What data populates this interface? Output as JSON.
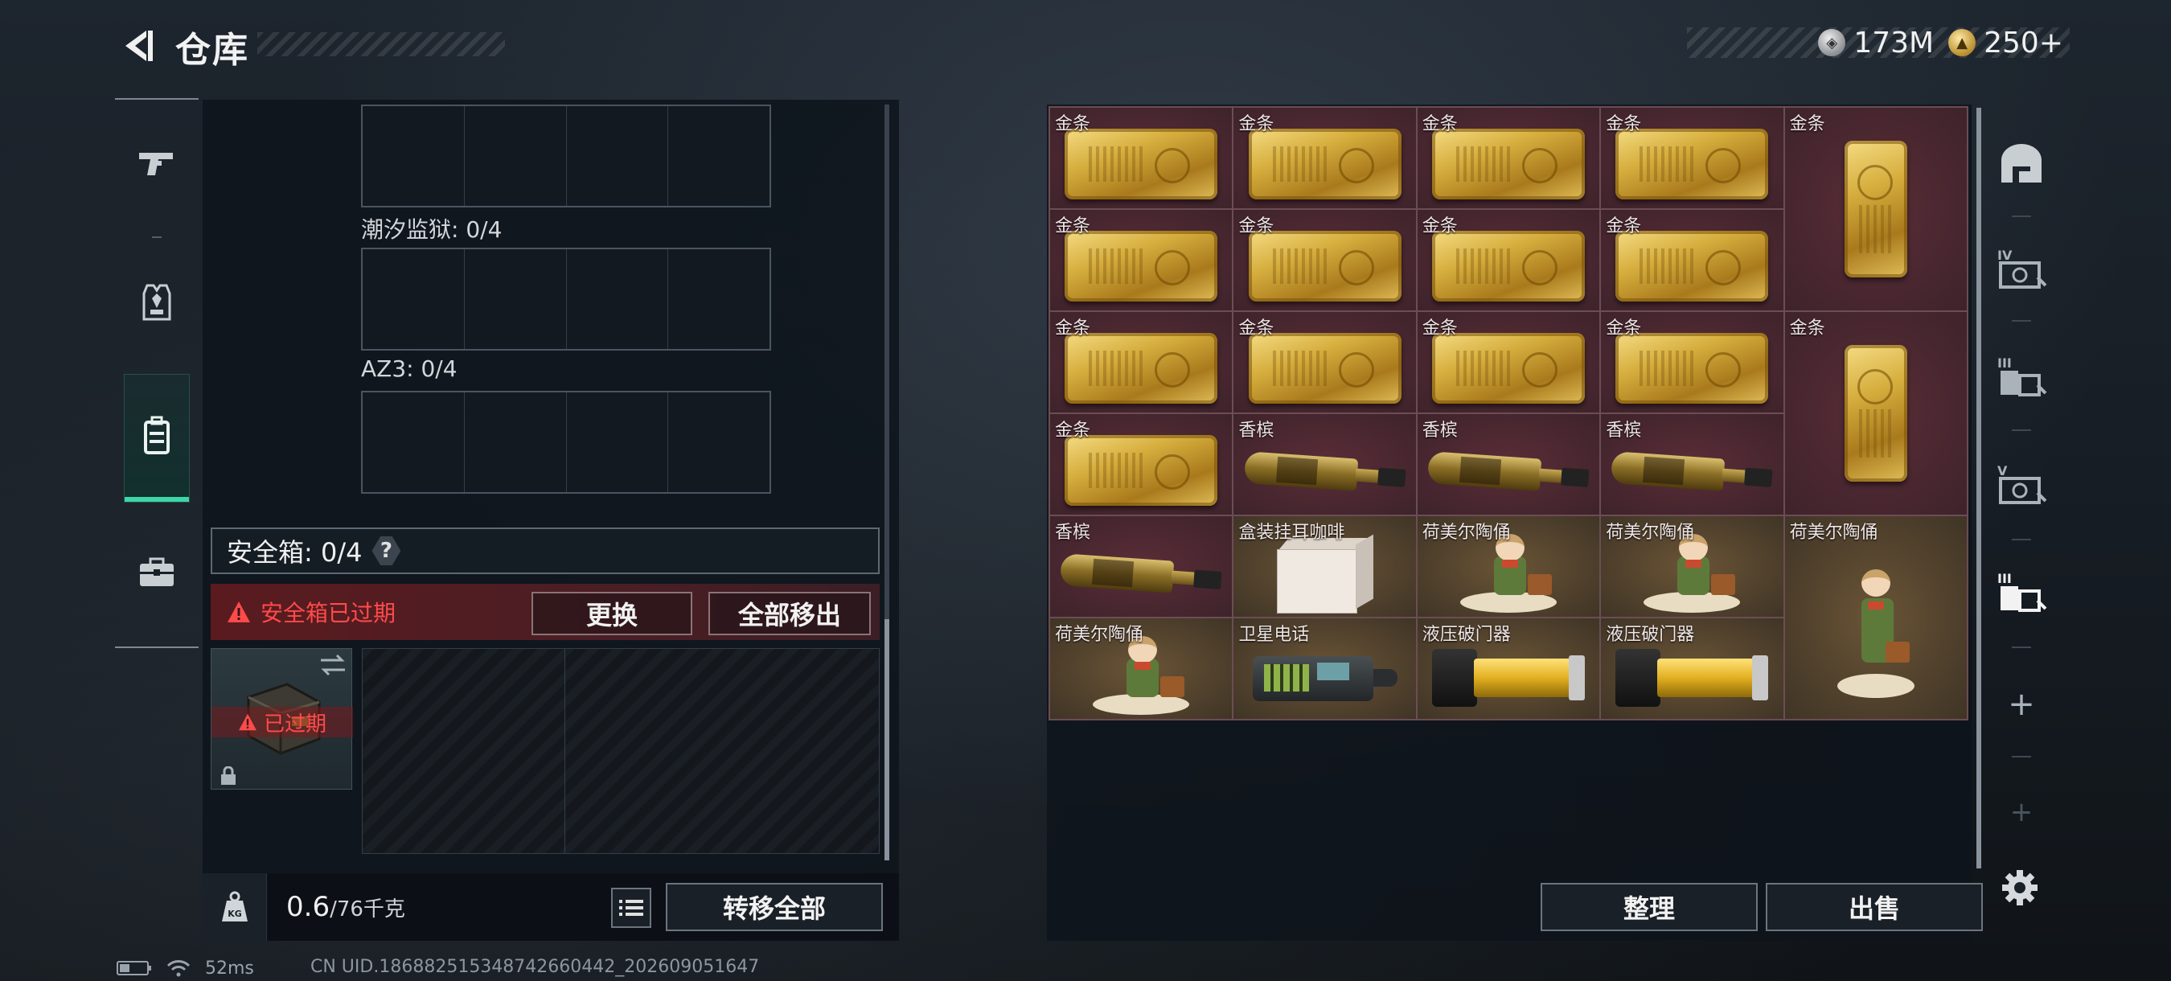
{
  "header": {
    "title": "仓库",
    "currencies": [
      {
        "name": "silver-coin-icon",
        "value": "173M"
      },
      {
        "name": "gold-coin-icon",
        "value": "250+"
      }
    ]
  },
  "left_nav": {
    "items": [
      {
        "icon": "pistol-icon",
        "active": false
      },
      {
        "icon": "armor-vest-icon",
        "active": false
      },
      {
        "icon": "backpack-icon",
        "active": true
      },
      {
        "icon": "briefcase-icon",
        "active": false
      }
    ]
  },
  "containers": {
    "labels": [
      "潮汐监狱: 0/4",
      "AZ3: 0/4"
    ]
  },
  "safe_box": {
    "label": "安全箱: 0/4",
    "help": "?",
    "expired_message": "安全箱已过期",
    "replace_button": "更换",
    "move_all_button": "全部移出",
    "card_status": "已过期"
  },
  "weight": {
    "current": "0.6",
    "capacity": "/76千克"
  },
  "transfer_all_button": "转移全部",
  "stash": {
    "items": [
      {
        "label": "金条",
        "type": "gold-bar",
        "bg": "red",
        "tall": false
      },
      {
        "label": "金条",
        "type": "gold-bar",
        "bg": "red",
        "tall": false
      },
      {
        "label": "金条",
        "type": "gold-bar",
        "bg": "red",
        "tall": false
      },
      {
        "label": "金条",
        "type": "gold-bar",
        "bg": "red",
        "tall": false
      },
      {
        "label": "金条",
        "type": "gold-bar-vertical",
        "bg": "red",
        "tall": true
      },
      {
        "label": "金条",
        "type": "gold-bar",
        "bg": "red",
        "tall": false
      },
      {
        "label": "金条",
        "type": "gold-bar",
        "bg": "red",
        "tall": false
      },
      {
        "label": "金条",
        "type": "gold-bar",
        "bg": "red",
        "tall": false
      },
      {
        "label": "金条",
        "type": "gold-bar",
        "bg": "red",
        "tall": false
      },
      {
        "label": "金条",
        "type": "gold-bar",
        "bg": "red",
        "tall": false
      },
      {
        "label": "金条",
        "type": "gold-bar",
        "bg": "red",
        "tall": false
      },
      {
        "label": "金条",
        "type": "gold-bar",
        "bg": "red",
        "tall": false
      },
      {
        "label": "金条",
        "type": "gold-bar",
        "bg": "red",
        "tall": false
      },
      {
        "label": "金条",
        "type": "gold-bar-vertical",
        "bg": "red",
        "tall": true
      },
      {
        "label": "金条",
        "type": "gold-bar",
        "bg": "red",
        "tall": false
      },
      {
        "label": "香槟",
        "type": "champagne",
        "bg": "red",
        "tall": false
      },
      {
        "label": "香槟",
        "type": "champagne",
        "bg": "red",
        "tall": false
      },
      {
        "label": "香槟",
        "type": "champagne",
        "bg": "red",
        "tall": false
      },
      {
        "label": "香槟",
        "type": "champagne",
        "bg": "red",
        "tall": false
      },
      {
        "label": "盒装挂耳咖啡",
        "type": "coffee-box",
        "bg": "brown",
        "tall": false
      },
      {
        "label": "荷美尔陶俑",
        "type": "figurine",
        "bg": "brown",
        "tall": false
      },
      {
        "label": "荷美尔陶俑",
        "type": "figurine",
        "bg": "brown",
        "tall": false
      },
      {
        "label": "荷美尔陶俑",
        "type": "figurine-tall",
        "bg": "brown",
        "tall": true
      },
      {
        "label": "荷美尔陶俑",
        "type": "figurine",
        "bg": "brown",
        "tall": false
      },
      {
        "label": "卫星电话",
        "type": "satellite-phone",
        "bg": "brown",
        "tall": false
      },
      {
        "label": "液压破门器",
        "type": "hydraulic-breacher",
        "bg": "brown",
        "tall": false
      },
      {
        "label": "液压破门器",
        "type": "hydraulic-breacher",
        "bg": "brown",
        "tall": false
      }
    ]
  },
  "right_nav": {
    "tabs": [
      {
        "icon": "stash-main-icon"
      },
      {
        "icon": "stash-tab-iv-icon",
        "roman": "IV"
      },
      {
        "icon": "stash-tab-iii-icon",
        "roman": "III"
      },
      {
        "icon": "stash-tab-v-icon",
        "roman": "V"
      },
      {
        "icon": "stash-tab-iii-active-icon",
        "roman": "III"
      },
      {
        "icon": "add-tab-icon",
        "glyph": "+"
      },
      {
        "icon": "add-tab-disabled-icon",
        "glyph": "+"
      }
    ]
  },
  "buttons": {
    "sort": "整理",
    "sell": "出售"
  },
  "status_bar": {
    "ping": "52ms",
    "uid": "CN UID.18688251534874266044​2_202609051647"
  }
}
